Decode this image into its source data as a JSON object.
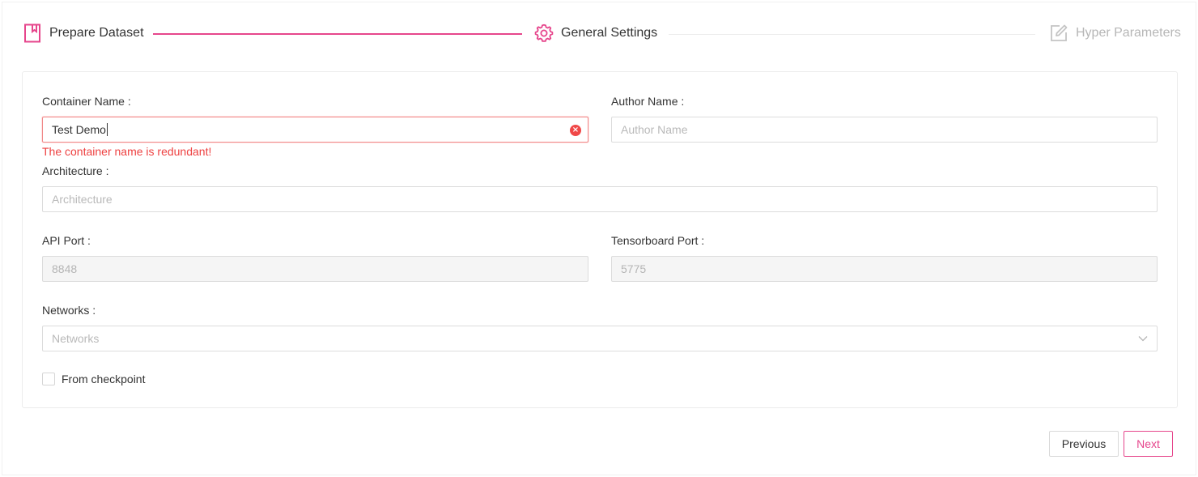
{
  "steps": [
    {
      "label": "Prepare Dataset",
      "icon": "bookmark-icon",
      "state": "done"
    },
    {
      "label": "General Settings",
      "icon": "gear-icon",
      "state": "active"
    },
    {
      "label": "Hyper Parameters",
      "icon": "edit-icon",
      "state": "todo"
    }
  ],
  "colors": {
    "accent": "#e6468c",
    "error": "#ee4141",
    "muted": "#b6b6b6"
  },
  "form": {
    "container_name": {
      "label": "Container Name :",
      "value": "Test Demo",
      "error": "The container name is redundant!"
    },
    "author_name": {
      "label": "Author Name :",
      "placeholder": "Author Name"
    },
    "architecture": {
      "label": "Architecture :",
      "placeholder": "Architecture"
    },
    "api_port": {
      "label": "API Port :",
      "value": "8848"
    },
    "tensorboard_port": {
      "label": "Tensorboard Port :",
      "value": "5775"
    },
    "networks": {
      "label": "Networks :",
      "placeholder": "Networks"
    },
    "from_checkpoint": {
      "label": "From checkpoint",
      "checked": false
    }
  },
  "actions": {
    "previous": "Previous",
    "next": "Next"
  }
}
